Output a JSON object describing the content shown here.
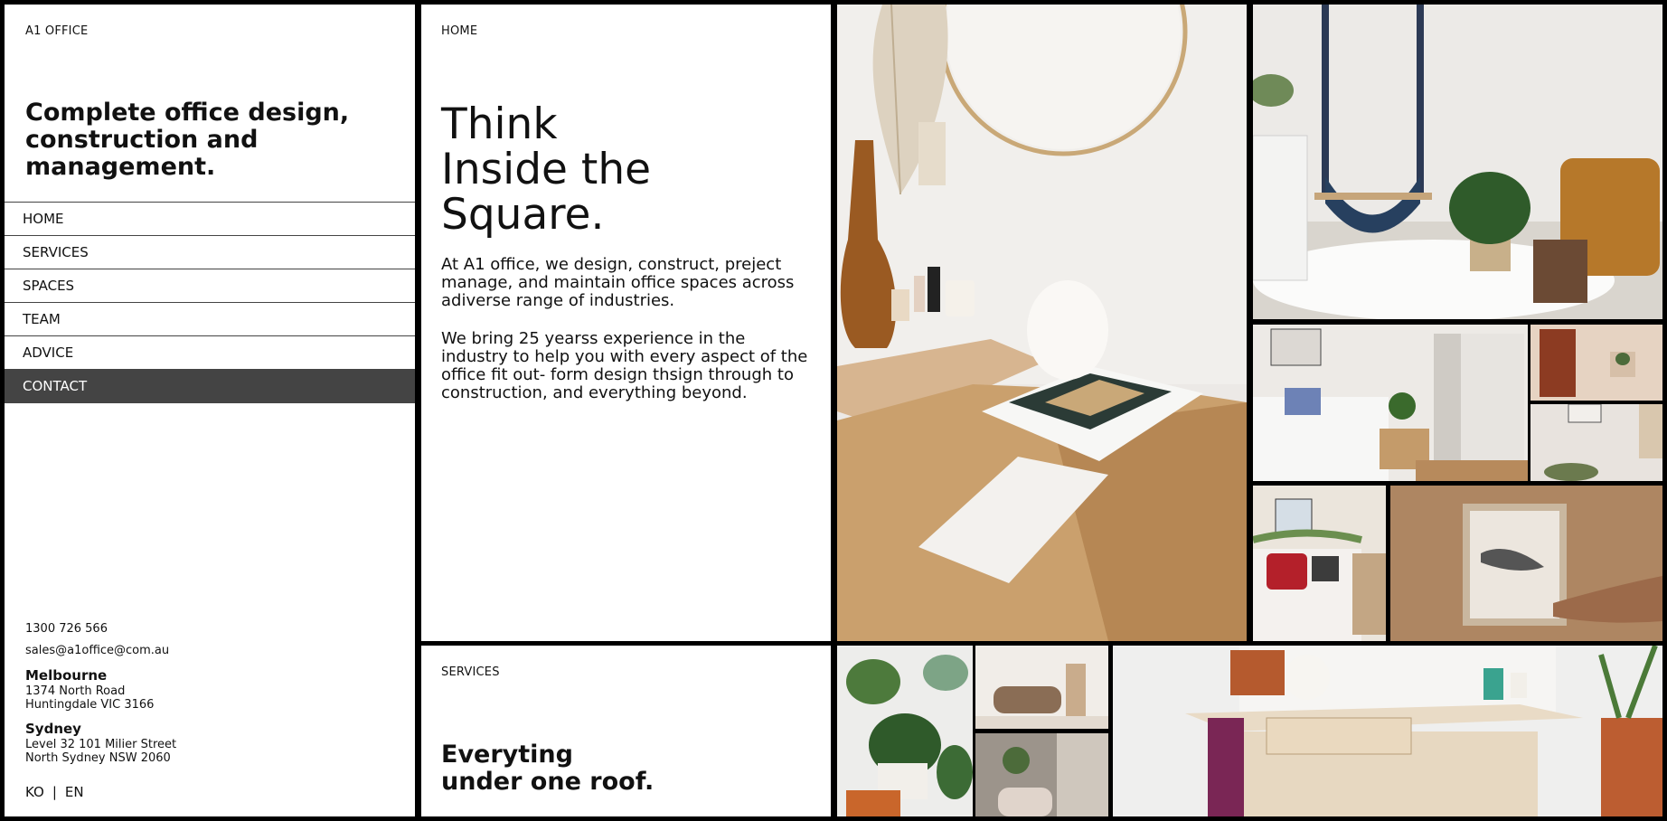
{
  "brand": "A1 OFFICE",
  "tagline": "Complete office design, construction and management.",
  "nav": [
    {
      "label": "HOME"
    },
    {
      "label": "SERVICES"
    },
    {
      "label": "SPACES"
    },
    {
      "label": "TEAM"
    },
    {
      "label": "ADVICE"
    },
    {
      "label": "CONTACT"
    }
  ],
  "contact": {
    "phone": "1300 726 566",
    "email": "sales@a1office@com.au",
    "offices": [
      {
        "city": "Melbourne",
        "line1": "1374 North Road",
        "line2": "Huntingdale VIC 3166"
      },
      {
        "city": "Sydney",
        "line1": "Level 32 101 Milier Street",
        "line2": "North Sydney NSW 2060"
      }
    ]
  },
  "lang": {
    "ko": "KO",
    "sep": "|",
    "en": "EN"
  },
  "hero": {
    "label": "HOME",
    "headline": [
      "Think",
      "Inside the",
      "Square."
    ],
    "paragraphs": [
      "At A1 office, we design, construct, preject manage, and maintain office spaces across adiverse range of industries.",
      "We bring 25 yearss experience in the industry to help you with every aspect of the office fit out- form design thsign through to construction, and everything beyond."
    ]
  },
  "services": {
    "label": "SERVICES",
    "headline": [
      "Everyting",
      "under one roof."
    ]
  }
}
